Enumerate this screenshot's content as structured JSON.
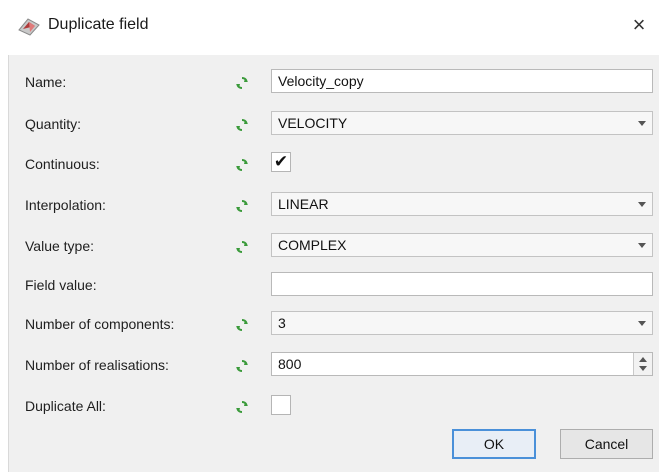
{
  "window": {
    "title": "Duplicate field",
    "close_glyph": "×",
    "app_icon": "app-logo-icon"
  },
  "form": {
    "name": {
      "label": "Name:",
      "value": "Velocity_copy"
    },
    "quantity": {
      "label": "Quantity:",
      "value": "VELOCITY"
    },
    "continuous": {
      "label": "Continuous:",
      "checked": true,
      "mark": "✔"
    },
    "interpolation": {
      "label": "Interpolation:",
      "value": "LINEAR"
    },
    "value_type": {
      "label": "Value type:",
      "value": "COMPLEX"
    },
    "field_value": {
      "label": "Field value:",
      "value": ""
    },
    "num_components": {
      "label": "Number of components:",
      "value": "3"
    },
    "num_realisations": {
      "label": "Number of realisations:",
      "value": "800"
    },
    "duplicate_all": {
      "label": "Duplicate All:",
      "checked": false,
      "mark": ""
    }
  },
  "buttons": {
    "ok": "OK",
    "cancel": "Cancel"
  },
  "icons": {
    "link": "green-arrows-icon"
  },
  "colors": {
    "accent": "#4a90d9",
    "link_icon": "#3a9a3a",
    "panel": "#f0f0f0"
  }
}
